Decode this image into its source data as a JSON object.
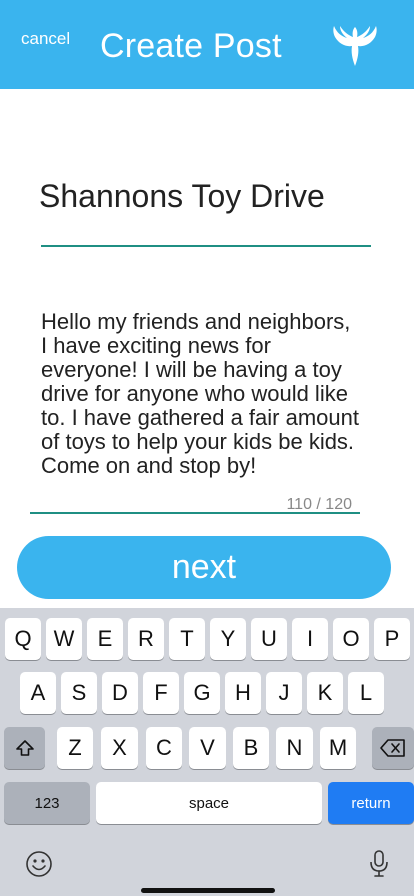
{
  "header": {
    "cancel_label": "cancel",
    "title": "Create Post",
    "logo_icon": "winged-bird-logo-icon"
  },
  "post": {
    "title_value": "Shannons Toy Drive",
    "body_value": "Hello my friends and neighbors, I have exciting news for everyone! I will be having a toy drive for anyone who would like to. I have gathered a fair amount of toys to help your kids be kids. Come on and stop by!",
    "char_count": "110 / 120"
  },
  "actions": {
    "next_label": "next"
  },
  "keyboard": {
    "row1": [
      "Q",
      "W",
      "E",
      "R",
      "T",
      "Y",
      "U",
      "I",
      "O",
      "P"
    ],
    "row2": [
      "A",
      "S",
      "D",
      "F",
      "G",
      "H",
      "J",
      "K",
      "L"
    ],
    "row3": [
      "Z",
      "X",
      "C",
      "V",
      "B",
      "N",
      "M"
    ],
    "shift_icon": "shift-icon",
    "delete_icon": "backspace-icon",
    "numbers_label": "123",
    "space_label": "space",
    "return_label": "return",
    "emoji_icon": "emoji-icon",
    "mic_icon": "microphone-icon"
  },
  "colors": {
    "accent": "#3ab4ee",
    "underline": "#1f8f83",
    "return_key": "#1f7cf3"
  }
}
